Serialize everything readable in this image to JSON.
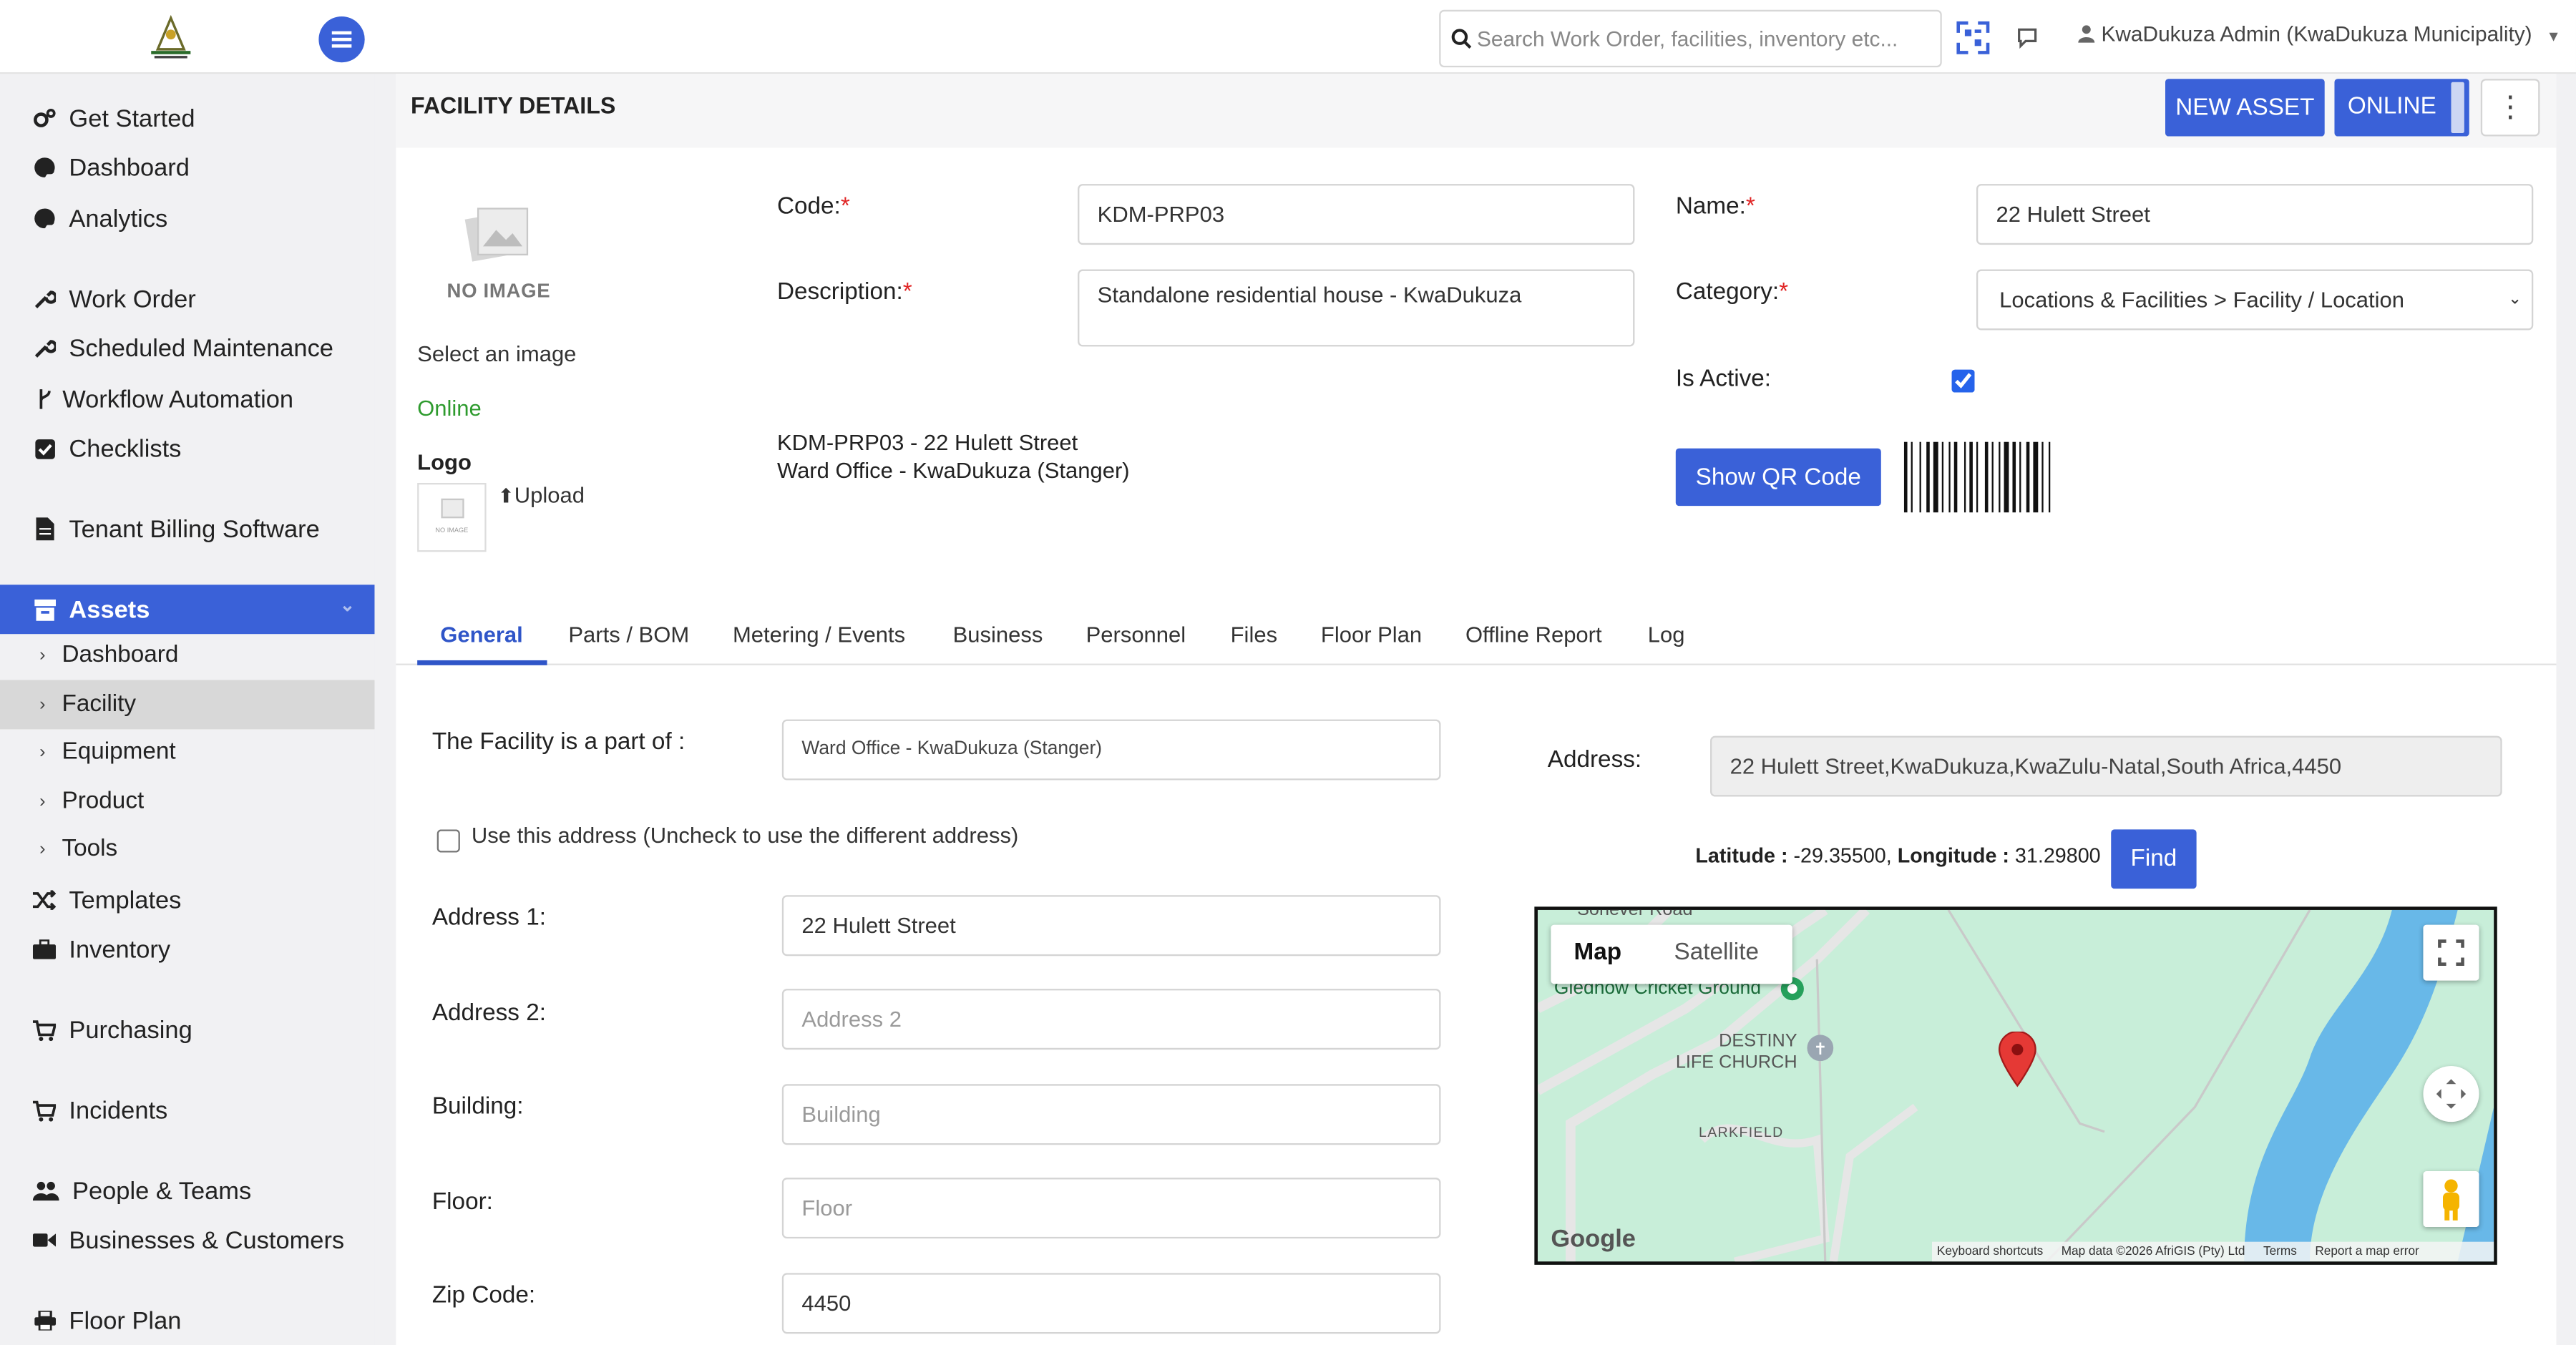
{
  "app": {
    "search_placeholder": "Search Work Order, facilities, inventory etc...",
    "user_label": "KwaDukuza Admin (KwaDukuza Municipality)",
    "accent_color": "#3a61d8"
  },
  "sidebar": {
    "items": [
      {
        "label": "Get Started",
        "icon": "gears-icon"
      },
      {
        "label": "Dashboard",
        "icon": "palette-icon"
      },
      {
        "label": "Analytics",
        "icon": "palette-icon"
      },
      {
        "label": "Work Order",
        "icon": "wrench-icon"
      },
      {
        "label": "Scheduled Maintenance",
        "icon": "wrench-icon"
      },
      {
        "label": "Workflow Automation",
        "icon": "branch-icon"
      },
      {
        "label": "Checklists",
        "icon": "check-square-icon"
      },
      {
        "label": "Tenant Billing Software",
        "icon": "document-icon"
      },
      {
        "label": "Assets",
        "icon": "archive-icon"
      },
      {
        "label": "Dashboard"
      },
      {
        "label": "Facility"
      },
      {
        "label": "Equipment"
      },
      {
        "label": "Product"
      },
      {
        "label": "Tools"
      },
      {
        "label": "Templates",
        "icon": "shuffle-icon"
      },
      {
        "label": "Inventory",
        "icon": "briefcase-icon"
      },
      {
        "label": "Purchasing",
        "icon": "cart-icon"
      },
      {
        "label": "Incidents",
        "icon": "cart-icon"
      },
      {
        "label": "People & Teams",
        "icon": "users-icon"
      },
      {
        "label": "Businesses & Customers",
        "icon": "video-icon"
      },
      {
        "label": "Floor Plan",
        "icon": "print-icon"
      }
    ]
  },
  "page": {
    "title": "FACILITY DETAILS",
    "new_asset_label": "NEW ASSET",
    "online_label": "ONLINE",
    "no_image_label": "NO IMAGE",
    "select_image_label": "Select an image",
    "status_text": "Online",
    "logo_label": "Logo",
    "upload_label": "Upload",
    "code_label": "Code:",
    "code_value": "KDM-PRP03",
    "name_label": "Name:",
    "name_value": "22 Hulett Street",
    "description_label": "Description:",
    "description_value": "Standalone residential house - KwaDukuza",
    "category_label": "Category:",
    "category_value": "Locations & Facilities > Facility / Location",
    "is_active_label": "Is Active:",
    "is_active": true,
    "summary_line1": "KDM-PRP03 - 22 Hulett Street",
    "summary_line2": "Ward Office - KwaDukuza (Stanger)",
    "qr_button_label": "Show QR Code"
  },
  "tabs": [
    "General",
    "Parts / BOM",
    "Metering / Events",
    "Business",
    "Personnel",
    "Files",
    "Floor Plan",
    "Offline Report",
    "Log"
  ],
  "general": {
    "part_of_label": "The Facility is a part of :",
    "part_of_value": "Ward Office - KwaDukuza (Stanger)",
    "use_address_label": "Use this address (Uncheck to use the different address)",
    "address1_label": "Address 1:",
    "address1_value": "22 Hulett Street",
    "address2_label": "Address 2:",
    "address2_placeholder": "Address 2",
    "building_label": "Building:",
    "building_placeholder": "Building",
    "floor_label": "Floor:",
    "floor_placeholder": "Floor",
    "zip_label": "Zip Code:",
    "zip_value": "4450",
    "address_label": "Address:",
    "address_value": "22 Hulett Street,KwaDukuza,KwaZulu-Natal,South Africa,4450",
    "latitude_label": "Latitude :",
    "latitude_value": " -29.35500,",
    "longitude_label": "Longitude :",
    "longitude_value": " 31.29800",
    "find_label": "Find"
  },
  "map": {
    "map_tab": "Map",
    "satellite_tab": "Satellite",
    "poi_cricket": "Gledhow Cricket Ground",
    "poi_church_line1": "DESTINY",
    "poi_church_line2": "LIFE CHURCH",
    "area_label": "LARKFIELD",
    "road_label": "Sonever Road",
    "brand": "Google",
    "footer_shortcuts": "Keyboard shortcuts",
    "footer_data": "Map data ©2026 AfriGIS (Pty) Ltd",
    "footer_terms": "Terms",
    "footer_report": "Report a map error"
  }
}
